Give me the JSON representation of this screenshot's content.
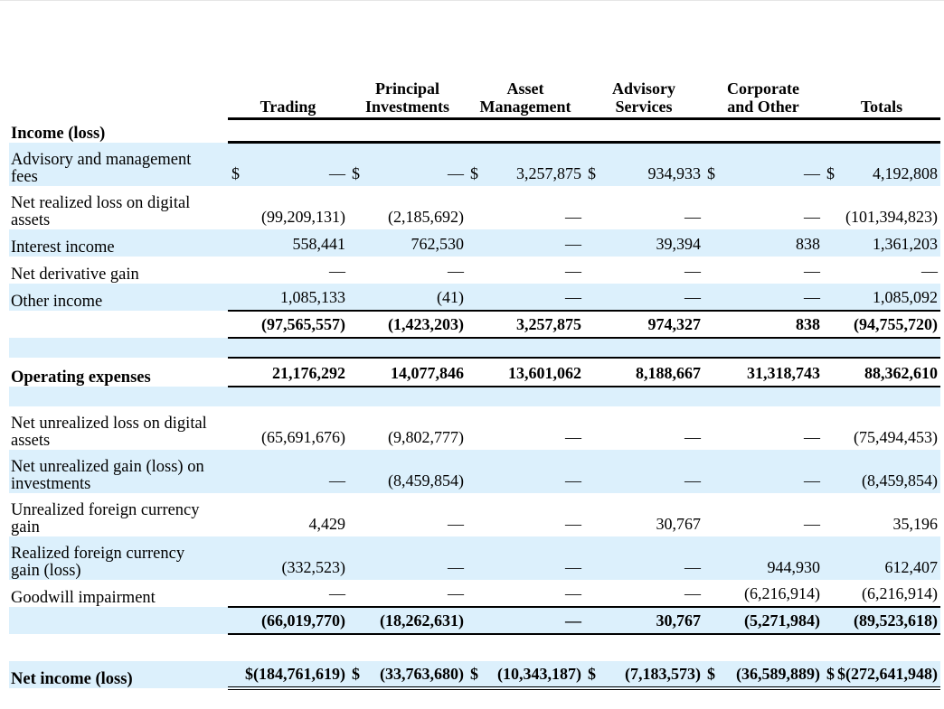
{
  "headers": {
    "trading": [
      "",
      "Trading"
    ],
    "principal": [
      "Principal",
      "Investments"
    ],
    "asset": [
      "Asset",
      "Management"
    ],
    "advisory": [
      "Advisory",
      "Services"
    ],
    "corporate": [
      "Corporate",
      "and Other"
    ],
    "totals": [
      "",
      "Totals"
    ]
  },
  "rows": [
    {
      "label": [
        "Income (loss)"
      ],
      "style": "section",
      "blue": false,
      "values": []
    },
    {
      "label": [
        "Advisory and management",
        "fees"
      ],
      "blue": true,
      "values": [
        {
          "cur": "$",
          "v": "—"
        },
        {
          "cur": "$",
          "v": "—"
        },
        {
          "cur": "$",
          "v": "3,257,875"
        },
        {
          "cur": "$",
          "v": "934,933"
        },
        {
          "cur": "$",
          "v": "—"
        },
        {
          "cur": "$",
          "v": "4,192,808"
        }
      ]
    },
    {
      "label": [
        "Net realized loss on digital",
        "assets"
      ],
      "blue": false,
      "values": [
        {
          "cur": "",
          "v": "(99,209,131)"
        },
        {
          "cur": "",
          "v": "(2,185,692)"
        },
        {
          "cur": "",
          "v": "—"
        },
        {
          "cur": "",
          "v": "—"
        },
        {
          "cur": "",
          "v": "—"
        },
        {
          "cur": "",
          "v": "(101,394,823)"
        }
      ]
    },
    {
      "label": [
        "Interest income"
      ],
      "blue": true,
      "values": [
        {
          "cur": "",
          "v": "558,441"
        },
        {
          "cur": "",
          "v": "762,530"
        },
        {
          "cur": "",
          "v": "—"
        },
        {
          "cur": "",
          "v": "39,394"
        },
        {
          "cur": "",
          "v": "838"
        },
        {
          "cur": "",
          "v": "1,361,203"
        }
      ]
    },
    {
      "label": [
        "Net derivative gain"
      ],
      "blue": false,
      "values": [
        {
          "cur": "",
          "v": "—"
        },
        {
          "cur": "",
          "v": "—"
        },
        {
          "cur": "",
          "v": "—"
        },
        {
          "cur": "",
          "v": "—"
        },
        {
          "cur": "",
          "v": "—"
        },
        {
          "cur": "",
          "v": "—"
        }
      ]
    },
    {
      "label": [
        "Other income"
      ],
      "blue": true,
      "values": [
        {
          "cur": "",
          "v": "1,085,133"
        },
        {
          "cur": "",
          "v": "(41)"
        },
        {
          "cur": "",
          "v": "—"
        },
        {
          "cur": "",
          "v": "—"
        },
        {
          "cur": "",
          "v": "—"
        },
        {
          "cur": "",
          "v": "1,085,092"
        }
      ]
    },
    {
      "label": [
        ""
      ],
      "style": "total",
      "blue": false,
      "values": [
        {
          "cur": "",
          "v": "(97,565,557)"
        },
        {
          "cur": "",
          "v": "(1,423,203)"
        },
        {
          "cur": "",
          "v": "3,257,875"
        },
        {
          "cur": "",
          "v": "974,327"
        },
        {
          "cur": "",
          "v": "838"
        },
        {
          "cur": "",
          "v": "(94,755,720)"
        }
      ]
    },
    {
      "label": [
        ""
      ],
      "style": "spacer",
      "blue": true,
      "values": []
    },
    {
      "label": [
        "Operating expenses"
      ],
      "style": "total",
      "bold_label": true,
      "blue": false,
      "values": [
        {
          "cur": "",
          "v": "21,176,292"
        },
        {
          "cur": "",
          "v": "14,077,846"
        },
        {
          "cur": "",
          "v": "13,601,062"
        },
        {
          "cur": "",
          "v": "8,188,667"
        },
        {
          "cur": "",
          "v": "31,318,743"
        },
        {
          "cur": "",
          "v": "88,362,610"
        }
      ]
    },
    {
      "label": [
        ""
      ],
      "style": "spacer",
      "blue": true,
      "values": []
    },
    {
      "label": [
        "Net unrealized loss on digital",
        "assets"
      ],
      "blue": false,
      "values": [
        {
          "cur": "",
          "v": "(65,691,676)"
        },
        {
          "cur": "",
          "v": "(9,802,777)"
        },
        {
          "cur": "",
          "v": "—"
        },
        {
          "cur": "",
          "v": "—"
        },
        {
          "cur": "",
          "v": "—"
        },
        {
          "cur": "",
          "v": "(75,494,453)"
        }
      ]
    },
    {
      "label": [
        "Net unrealized gain (loss) on",
        "investments"
      ],
      "blue": true,
      "values": [
        {
          "cur": "",
          "v": "—"
        },
        {
          "cur": "",
          "v": "(8,459,854)"
        },
        {
          "cur": "",
          "v": "—"
        },
        {
          "cur": "",
          "v": "—"
        },
        {
          "cur": "",
          "v": "—"
        },
        {
          "cur": "",
          "v": "(8,459,854)"
        }
      ]
    },
    {
      "label": [
        "Unrealized foreign currency",
        "gain"
      ],
      "blue": false,
      "values": [
        {
          "cur": "",
          "v": "4,429"
        },
        {
          "cur": "",
          "v": "—"
        },
        {
          "cur": "",
          "v": "—"
        },
        {
          "cur": "",
          "v": "30,767"
        },
        {
          "cur": "",
          "v": "—"
        },
        {
          "cur": "",
          "v": "35,196"
        }
      ]
    },
    {
      "label": [
        "Realized foreign currency",
        "gain (loss)"
      ],
      "blue": true,
      "values": [
        {
          "cur": "",
          "v": "(332,523)"
        },
        {
          "cur": "",
          "v": "—"
        },
        {
          "cur": "",
          "v": "—"
        },
        {
          "cur": "",
          "v": "—"
        },
        {
          "cur": "",
          "v": "944,930"
        },
        {
          "cur": "",
          "v": "612,407"
        }
      ]
    },
    {
      "label": [
        "Goodwill impairment"
      ],
      "blue": false,
      "values": [
        {
          "cur": "",
          "v": "—"
        },
        {
          "cur": "",
          "v": "—"
        },
        {
          "cur": "",
          "v": "—"
        },
        {
          "cur": "",
          "v": "—"
        },
        {
          "cur": "",
          "v": "(6,216,914)"
        },
        {
          "cur": "",
          "v": "(6,216,914)"
        }
      ]
    },
    {
      "label": [
        ""
      ],
      "style": "total",
      "blue": true,
      "values": [
        {
          "cur": "",
          "v": "(66,019,770)"
        },
        {
          "cur": "",
          "v": "(18,262,631)"
        },
        {
          "cur": "",
          "v": "—"
        },
        {
          "cur": "",
          "v": "30,767"
        },
        {
          "cur": "",
          "v": "(5,271,984)"
        },
        {
          "cur": "",
          "v": "(89,523,618)"
        }
      ]
    },
    {
      "label": [
        ""
      ],
      "style": "spacer",
      "blue": false,
      "values": []
    },
    {
      "label": [
        "Net income (loss)"
      ],
      "style": "net",
      "blue": true,
      "values": [
        {
          "cur": "",
          "v": "$(184,761,619)"
        },
        {
          "cur": "$",
          "v": "(33,763,680)"
        },
        {
          "cur": "$",
          "v": "(10,343,187)"
        },
        {
          "cur": "$",
          "v": "(7,183,573)"
        },
        {
          "cur": "$",
          "v": "(36,589,889)"
        },
        {
          "cur": "$",
          "v": "$(272,641,948)"
        }
      ]
    }
  ]
}
